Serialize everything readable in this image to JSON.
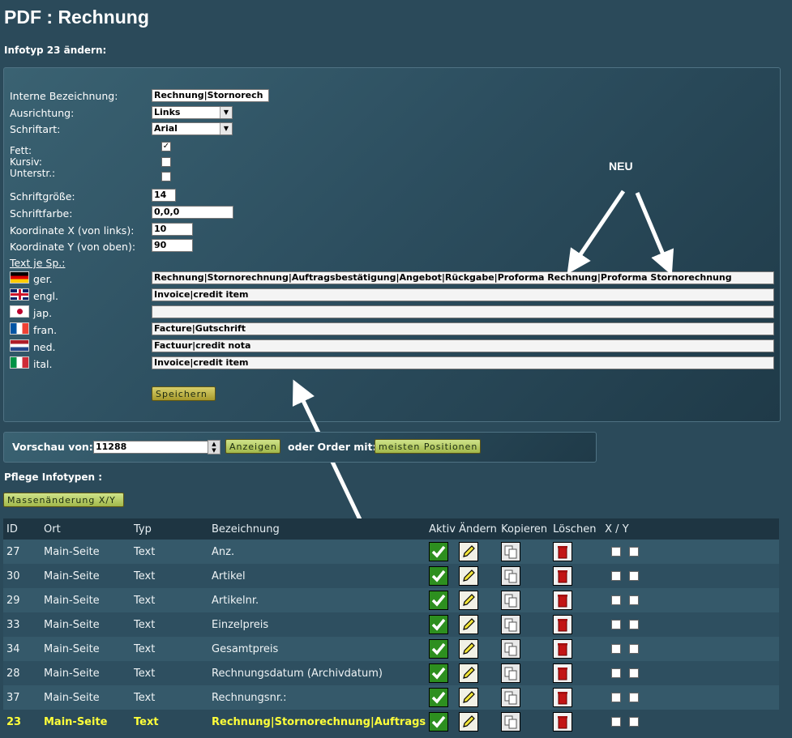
{
  "page": {
    "title": "PDF : Rechnung",
    "subtitle": "Infotyp 23 ändern:"
  },
  "form": {
    "labels": {
      "intern": "Interne Bezeichnung:",
      "ausrichtung": "Ausrichtung:",
      "schriftart": "Schriftart:",
      "fett": "Fett:",
      "kursiv": "Kursiv:",
      "unterstr": "Unterstr.:",
      "groesse": "Schriftgröße:",
      "farbe": "Schriftfarbe:",
      "x": "Koordinate X (von links):",
      "y": "Koordinate Y (von oben):",
      "text_je_sp": "Text je Sp.:"
    },
    "values": {
      "intern": "Rechnung|Stornorech",
      "ausrichtung": "Links",
      "schriftart": "Arial",
      "fett_checked": "✓",
      "groesse": "14",
      "farbe": "0,0,0",
      "x": "10",
      "y": "90"
    },
    "languages": [
      {
        "label": "ger.",
        "value": "Rechnung|Stornorechnung|Auftragsbestätigung|Angebot|Rückgabe|Proforma Rechnung|Proforma Stornorechnung"
      },
      {
        "label": "engl.",
        "value": "Invoice|credit item"
      },
      {
        "label": "jap.",
        "value": ""
      },
      {
        "label": "fran.",
        "value": "Facture|Gutschrift"
      },
      {
        "label": "ned.",
        "value": "Factuur|credit nota"
      },
      {
        "label": "ital.",
        "value": "Invoice|credit item"
      }
    ],
    "save_label": "Speichern"
  },
  "annotation": {
    "label": "NEU"
  },
  "preview": {
    "label": "Vorschau von:",
    "value": "11288",
    "show_label": "Anzeigen",
    "or_label": "oder Order mit:",
    "most_label": "meisten Positionen"
  },
  "pflege": {
    "label": "Pflege Infotypen :",
    "mass_label": "Massenänderung X/Y"
  },
  "table": {
    "headers": [
      "ID",
      "Ort",
      "Typ",
      "Bezeichnung",
      "Aktiv",
      "Ändern",
      "Kopieren",
      "Löschen",
      "X / Y"
    ],
    "rows": [
      {
        "id": "27",
        "ort": "Main-Seite",
        "typ": "Text",
        "bez": "Anz."
      },
      {
        "id": "30",
        "ort": "Main-Seite",
        "typ": "Text",
        "bez": "Artikel"
      },
      {
        "id": "29",
        "ort": "Main-Seite",
        "typ": "Text",
        "bez": "Artikelnr."
      },
      {
        "id": "33",
        "ort": "Main-Seite",
        "typ": "Text",
        "bez": "Einzelpreis"
      },
      {
        "id": "34",
        "ort": "Main-Seite",
        "typ": "Text",
        "bez": "Gesamtpreis"
      },
      {
        "id": "28",
        "ort": "Main-Seite",
        "typ": "Text",
        "bez": "Rechnungsdatum (Archivdatum)"
      },
      {
        "id": "37",
        "ort": "Main-Seite",
        "typ": "Text",
        "bez": "Rechnungsnr.:"
      },
      {
        "id": "23",
        "ort": "Main-Seite",
        "typ": "Text",
        "bez": "Rechnung|Stornorechnung|Auftrags"
      }
    ]
  },
  "colors": {
    "background": "#2b4a5a",
    "highlight_text": "#ffff3a",
    "button": "#c9bd4c"
  }
}
